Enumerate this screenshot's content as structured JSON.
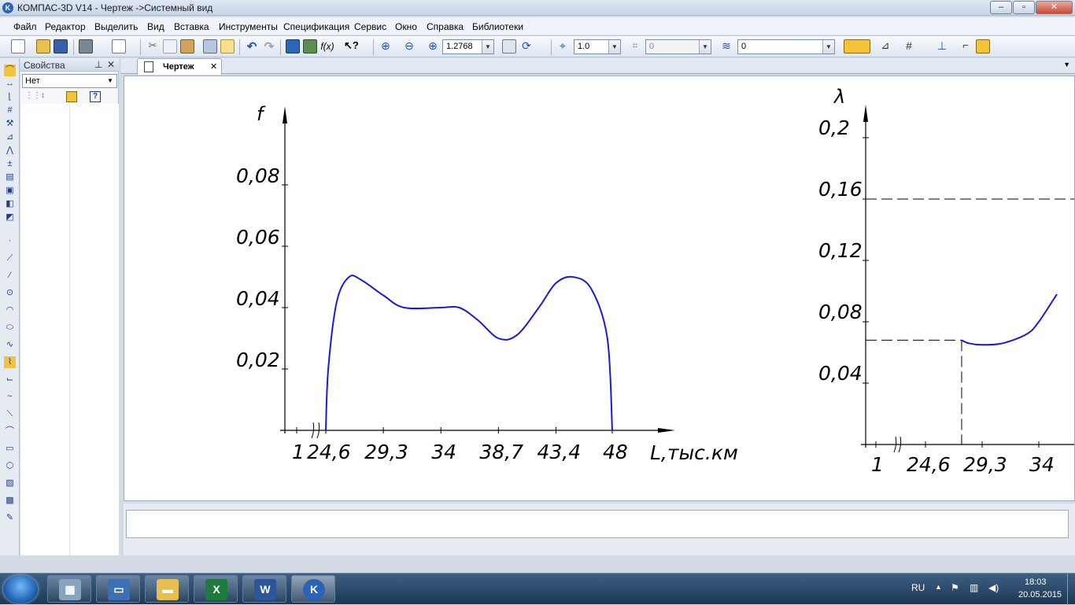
{
  "window": {
    "title": "КОМПАС-3D V14 - Чертеж ->Системный вид"
  },
  "menu": {
    "items": [
      "Файл",
      "Редактор",
      "Выделить",
      "Вид",
      "Вставка",
      "Инструменты",
      "Спецификация",
      "Сервис",
      "Окно",
      "Справка",
      "Библиотеки"
    ]
  },
  "toolbar": {
    "zoom_value": "1.2768",
    "step_value": "1.0",
    "angle_value": "0",
    "layer_value": "0"
  },
  "properties_panel": {
    "title": "Свойства",
    "selection": "Нет"
  },
  "document_tab": {
    "label": "Чертеж"
  },
  "chart_data": [
    {
      "type": "line",
      "ylabel": "f",
      "xlabel": "L,тыс.км",
      "x_ticks": [
        "1",
        "24,6",
        "29,3",
        "34",
        "38,7",
        "43,4",
        "48"
      ],
      "y_ticks": [
        "0,02",
        "0,04",
        "0,06",
        "0,08"
      ],
      "axis_break": true,
      "series": [
        {
          "x": [
            24.6,
            24.8,
            25.5,
            26.5,
            27.5,
            29.3,
            31,
            34,
            35.5,
            37,
            38.7,
            40.2,
            42,
            43.4,
            44.8,
            46.3,
            47.6,
            48
          ],
          "y": [
            0,
            0.02,
            0.042,
            0.05,
            0.049,
            0.044,
            0.04,
            0.04,
            0.04,
            0.036,
            0.03,
            0.031,
            0.04,
            0.048,
            0.05,
            0.046,
            0.03,
            0
          ]
        }
      ]
    },
    {
      "type": "line",
      "ylabel": "λ",
      "x_ticks": [
        "1",
        "24,6",
        "29,3",
        "34"
      ],
      "y_ticks": [
        "0,04",
        "0,08",
        "0,12",
        "0,16",
        "0,2"
      ],
      "axis_break": true,
      "series": [
        {
          "x": [
            27.6,
            28.2,
            29.3,
            31,
            33,
            34,
            35.5
          ],
          "y": [
            0.068,
            0.066,
            0.065,
            0.066,
            0.072,
            0.08,
            0.098
          ]
        }
      ]
    }
  ],
  "taskbar": {
    "language": "RU",
    "time": "18:03",
    "date": "20.05.2015"
  }
}
